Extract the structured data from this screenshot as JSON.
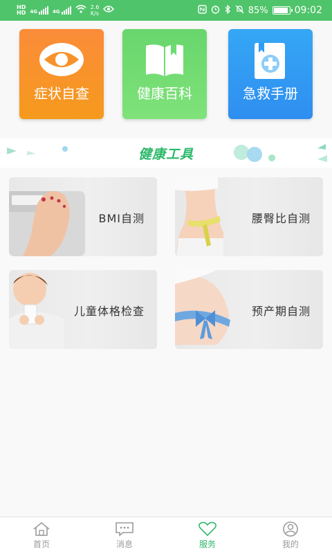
{
  "status_bar": {
    "left_tag_1": "HD",
    "left_tag_2": "HD",
    "network_1": "4G",
    "network_2": "4G",
    "speed_value": "2.6",
    "speed_unit": "K/s",
    "battery_percent": "85%",
    "time": "09:02"
  },
  "top_tiles": [
    {
      "label": "症状自查",
      "icon": "eye-icon",
      "color": "#f7922b"
    },
    {
      "label": "健康百科",
      "icon": "book-icon",
      "color": "#6fdc71"
    },
    {
      "label": "急救手册",
      "icon": "medical-book-icon",
      "color": "#319cf3"
    }
  ],
  "banner": {
    "title": "健康工具",
    "accent": "#2db86a"
  },
  "tools": [
    {
      "label": "BMI自测",
      "image": "scale-feet"
    },
    {
      "label": "腰臀比自测",
      "image": "waist-tape"
    },
    {
      "label": "儿童体格检查",
      "image": "child-milk"
    },
    {
      "label": "预产期自测",
      "image": "pregnant-belly"
    }
  ],
  "bottom_nav": {
    "items": [
      {
        "label": "首页",
        "icon": "home-icon"
      },
      {
        "label": "消息",
        "icon": "message-icon"
      },
      {
        "label": "服务",
        "icon": "heart-icon"
      },
      {
        "label": "我的",
        "icon": "user-icon"
      }
    ],
    "active_index": 2,
    "active_color": "#2db86a"
  }
}
